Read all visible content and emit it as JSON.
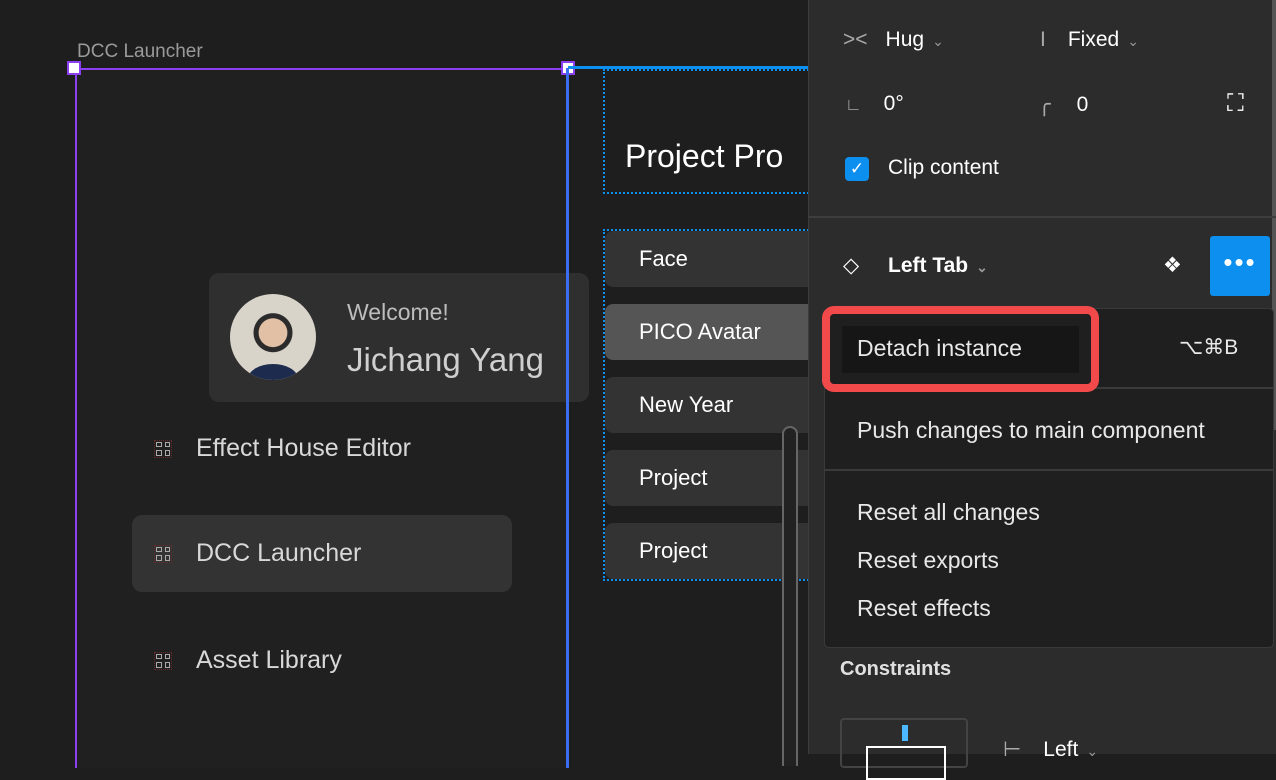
{
  "canvas": {
    "frame_label": "DCC Launcher",
    "page_title": "Project Pro"
  },
  "sidebar": {
    "welcome": "Welcome!",
    "user_name": "Jichang Yang",
    "items": [
      {
        "label": "Effect House Editor"
      },
      {
        "label": "DCC Launcher",
        "active": true
      },
      {
        "label": "Asset Library"
      }
    ]
  },
  "projects": [
    {
      "label": "Face"
    },
    {
      "label": "PICO Avatar",
      "selected": true
    },
    {
      "label": "New Year"
    },
    {
      "label": "Project"
    },
    {
      "label": "Project"
    }
  ],
  "panel": {
    "width_mode": "Hug",
    "height_mode": "Fixed",
    "rotation": "0°",
    "radius": "0",
    "clip_content": "Clip content",
    "clip_checked": true,
    "component_name": "Left Tab",
    "constraints_title": "Constraints",
    "constraint_h": "Left"
  },
  "menu": {
    "detach": "Detach instance",
    "detach_shortcut": "⌥⌘B",
    "push": "Push changes to main component",
    "reset_all": "Reset all changes",
    "reset_exports": "Reset exports",
    "reset_effects": "Reset effects"
  },
  "colors": {
    "accent": "#0d8ff0",
    "selection": "#8a3ff0",
    "highlight": "#f24a4a"
  }
}
